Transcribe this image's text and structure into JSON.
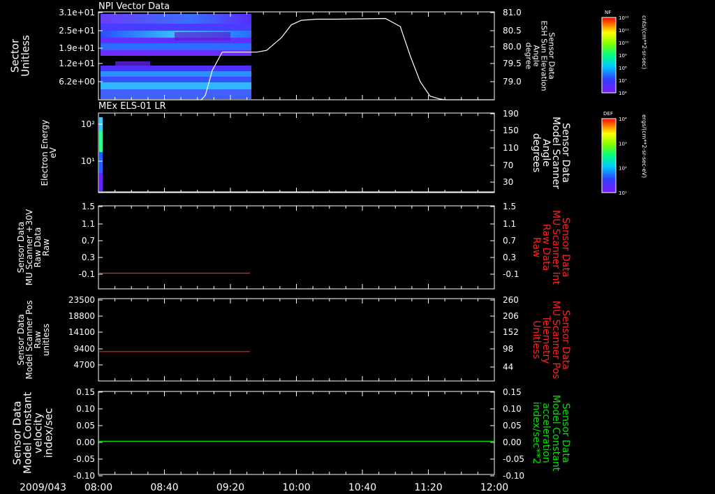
{
  "date_label": "2009/043",
  "time_ticks": [
    "08:00",
    "08:40",
    "09:20",
    "10:00",
    "10:40",
    "11:20",
    "12:00"
  ],
  "chart_data": [
    {
      "type": "heatmap",
      "title": "NPI Vector Data",
      "ylabel_left": [
        "Sector",
        "Unitless"
      ],
      "yticks_left": [
        "3.1e+01",
        "2.5e+01",
        "1.9e+01",
        "1.2e+01",
        "6.2e+00"
      ],
      "ylabel_right": [
        "Sensor Data",
        "ESH Sun Elevation",
        "Angle",
        "degree"
      ],
      "yticks_right": [
        "81.0",
        "80.5",
        "80.0",
        "79.5",
        "79.0"
      ],
      "ylim_right": [
        78.6,
        81.0
      ],
      "x_hours": [
        0,
        1.0,
        1.04,
        1.08,
        1.15,
        1.25,
        1.6,
        1.7,
        1.85,
        1.95,
        2.05,
        2.2,
        2.4,
        2.9,
        3.05,
        3.15,
        3.25,
        3.35,
        3.45,
        3.5,
        4.0
      ],
      "y_line": [
        78.6,
        78.6,
        78.6,
        78.72,
        79.4,
        79.9,
        79.9,
        79.95,
        80.3,
        80.65,
        80.77,
        80.8,
        80.8,
        80.82,
        80.6,
        79.8,
        79.1,
        78.7,
        78.62,
        78.6,
        78.6
      ],
      "data_end_hour": 1.47,
      "colorbar": {
        "label": "NF",
        "units": "cnts/(cm**2-sr-sec)",
        "ticks": [
          "10¹²",
          "10¹¹",
          "10¹⁰",
          "10⁹",
          "10⁸",
          "10⁷",
          "10⁶"
        ]
      }
    },
    {
      "type": "heatmap",
      "title": "MEx ELS-01 LR",
      "ylabel_left": [
        "Electron Energy",
        "eV"
      ],
      "yticks_left": [
        "10²",
        "10¹"
      ],
      "ylabel_right": [
        "Sensor Data",
        "Model Scanner",
        "Angle",
        "degrees"
      ],
      "yticks_right": [
        "190",
        "150",
        "110",
        "70",
        "30"
      ],
      "ylim_right": [
        0,
        190
      ],
      "line_value": 0,
      "colorbar": {
        "label": "DEF",
        "units": "ergs/(cm**2-sr-sec-eV)",
        "ticks": [
          "10⁴",
          "10³",
          "10²",
          "10¹"
        ]
      }
    },
    {
      "type": "line",
      "ylabel_left": [
        "Sensor Data",
        "MU Scanner +30V",
        "Raw Data",
        "Raw"
      ],
      "yticks_left": [
        "1.5",
        "1.1",
        "0.7",
        "0.3",
        "-0.1"
      ],
      "ylabel_right": [
        "Sensor Data",
        "MU Scanner Int",
        "Raw Data",
        "Raw"
      ],
      "yticks_right": [
        "1.5",
        "1.1",
        "0.7",
        "0.3",
        "-0.1"
      ],
      "ylim": [
        -0.35,
        1.5
      ],
      "series": [
        {
          "x_hours": [
            0,
            1.53
          ],
          "values": [
            0,
            0
          ],
          "color": "#ff2020"
        }
      ]
    },
    {
      "type": "line",
      "ylabel_left": [
        "Sensor Data",
        "Model Scanner Pos",
        "Raw",
        "unitless"
      ],
      "yticks_left": [
        "23500",
        "18800",
        "14100",
        "9400",
        "4700"
      ],
      "ylabel_right": [
        "Sensor Data",
        "MU Scanner Pos",
        "Telemetry",
        "Unitless"
      ],
      "yticks_right": [
        "260",
        "206",
        "152",
        "98",
        "44"
      ],
      "ylim": [
        0,
        23500
      ],
      "series": [
        {
          "x_hours": [
            0,
            1.53
          ],
          "values": [
            8400,
            8400
          ],
          "color": "#ff2020"
        }
      ]
    },
    {
      "type": "line",
      "ylabel_left": [
        "Sensor Data",
        "Model Constant",
        "velocity",
        "index/sec"
      ],
      "yticks_left": [
        "0.15",
        "0.10",
        "0.05",
        "0.00",
        "-0.05",
        "-0.10"
      ],
      "ylabel_right": [
        "Sensor Data",
        "Model Constant",
        "acceleration",
        "index/sec**2"
      ],
      "yticks_right": [
        "0.15",
        "0.10",
        "0.05",
        "0.00",
        "-0.05",
        "-0.10"
      ],
      "ylim": [
        -0.1,
        0.15
      ],
      "series": [
        {
          "x_hours": [
            0,
            4.0
          ],
          "values": [
            0,
            0
          ],
          "color": "#00e000"
        }
      ]
    }
  ],
  "colors": {
    "red_label": "#ff2020",
    "green_label": "#00e000",
    "axis": "#ffffff"
  }
}
